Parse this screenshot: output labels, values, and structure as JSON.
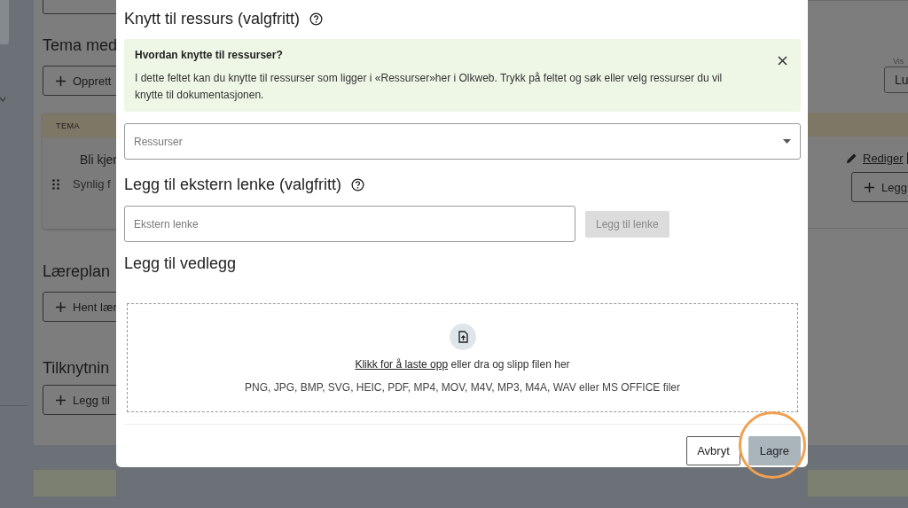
{
  "background": {
    "left": {
      "headings": [
        "Tema med",
        "Læreplan",
        "Tilknytnin"
      ],
      "buttons": [
        "Opprett",
        "Hent lær",
        "Legg til"
      ],
      "table": {
        "column": "TEMA",
        "row": {
          "title": "Bli kjer",
          "subtitle": "Synlig f"
        }
      }
    },
    "right": {
      "view_select": {
        "label": "Vis",
        "value": "Lu"
      },
      "edit_link": "Rediger",
      "add_button": "Legg"
    }
  },
  "modal": {
    "resource_section": {
      "title": "Knytt til ressurs (valgfritt)",
      "info": {
        "title": "Hvordan knytte til ressurser?",
        "text": "I dette feltet kan du knytte til ressurser som ligger i «Ressurser»her i Olkweb. Trykk på feltet og søk eller velg ressurser du vil knytte til dokumentasjonen."
      },
      "select": {
        "placeholder": "Ressurser"
      }
    },
    "link_section": {
      "title": "Legg til ekstern lenke (valgfritt)",
      "input": {
        "placeholder": "Ekstern lenke"
      },
      "button": {
        "label": "Legg til lenke",
        "disabled": true
      }
    },
    "attachment_section": {
      "title": "Legg til vedlegg",
      "upload_link": "Klikk for å laste opp",
      "upload_text": "eller dra og slipp filen her",
      "formats": "PNG, JPG, BMP, SVG, HEIC, PDF, MP4, MOV, M4V, MP3, M4A, WAV eller MS OFFICE filer"
    },
    "footer": [
      {
        "label": "Avbryt",
        "kind": "secondary",
        "highlighted": false
      },
      {
        "label": "Lagre",
        "kind": "primary",
        "highlighted": true
      }
    ]
  }
}
